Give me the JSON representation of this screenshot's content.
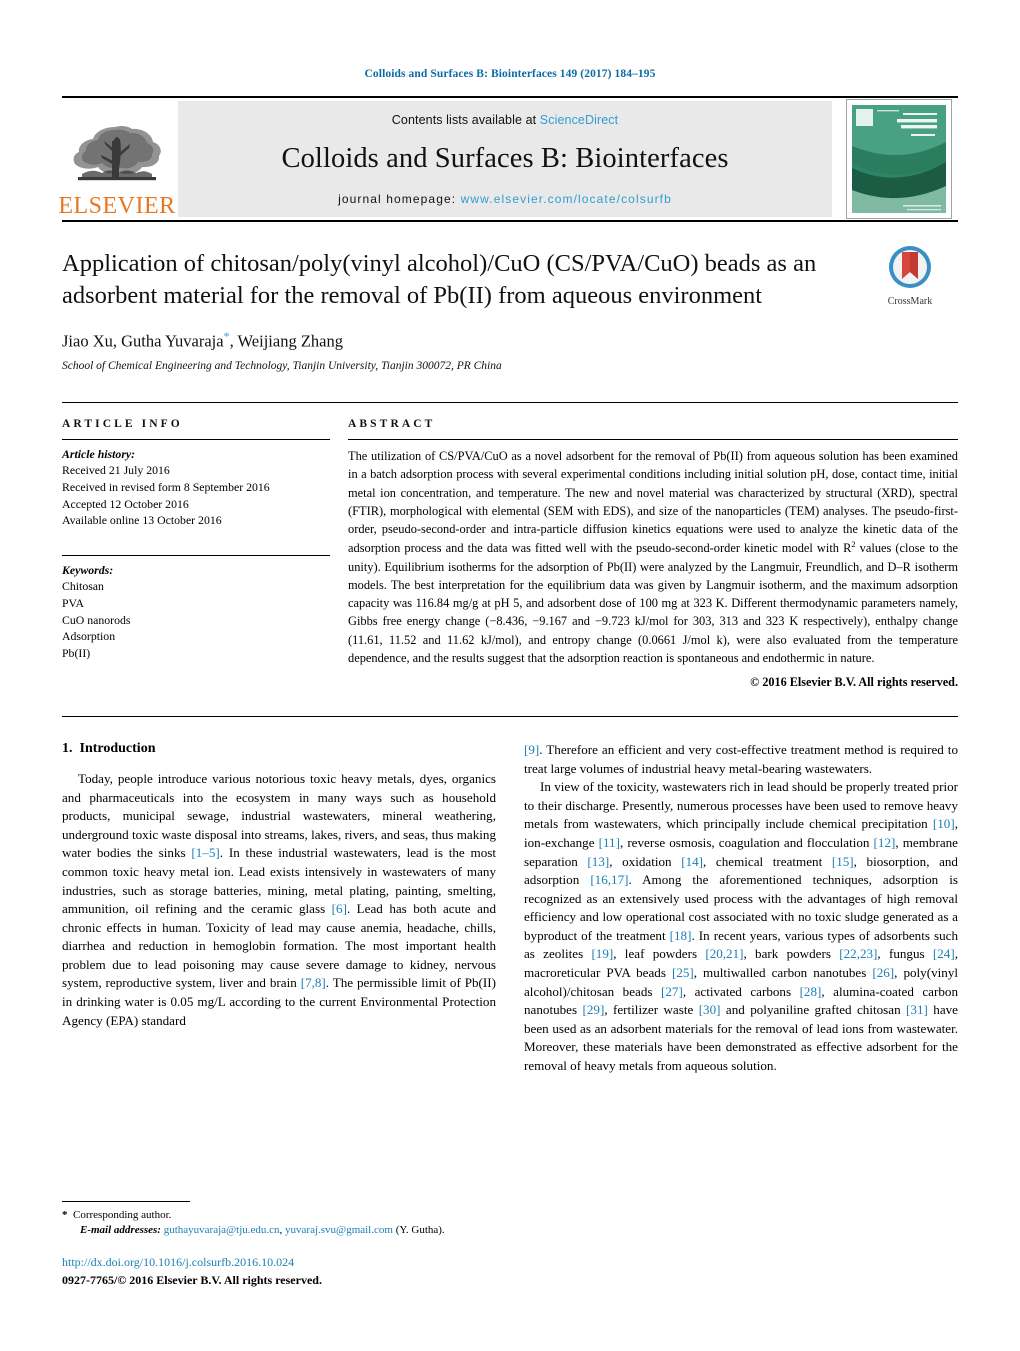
{
  "running_head": "Colloids and Surfaces B: Biointerfaces 149 (2017) 184–195",
  "masthead": {
    "publisher_name": "ELSEVIER",
    "contents_prefix": "Contents lists available at ",
    "contents_link": "ScienceDirect",
    "journal_title": "Colloids and Surfaces B: Biointerfaces",
    "homepage_prefix": "journal homepage: ",
    "homepage_url": "www.elsevier.com/locate/colsurfb",
    "cover_title_small": "An International Journal of",
    "cover_title_main": "COLLOIDS AND SURFACES B",
    "cover_subtitle": "Biointerfaces",
    "link_color": "#2f9fd0"
  },
  "article": {
    "title": "Application of chitosan/poly(vinyl alcohol)/CuO (CS/PVA/CuO) beads as an adsorbent material for the removal of Pb(II) from aqueous environment",
    "crossmark_label": "CrossMark",
    "authors": "Jiao Xu, Gutha Yuvaraja",
    "authors_tail": ", Weijiang Zhang",
    "corresponding_marker": "*",
    "affiliation": "School of Chemical Engineering and Technology, Tianjin University, Tianjin 300072, PR China"
  },
  "article_info": {
    "heading": "ARTICLE INFO",
    "history_label": "Article history:",
    "history": [
      "Received 21 July 2016",
      "Received in revised form 8 September 2016",
      "Accepted 12 October 2016",
      "Available online 13 October 2016"
    ],
    "keywords_label": "Keywords:",
    "keywords": [
      "Chitosan",
      "PVA",
      "CuO nanorods",
      "Adsorption",
      "Pb(II)"
    ]
  },
  "abstract": {
    "heading": "ABSTRACT",
    "text_part1": "The utilization of CS/PVA/CuO as a novel adsorbent for the removal of Pb(II) from aqueous solution has been examined in a batch adsorption process with several experimental conditions including initial solution pH, dose, contact time, initial metal ion concentration, and temperature. The new and novel material was characterized by structural (XRD), spectral (FTIR), morphological with elemental (SEM with EDS), and size of the nanoparticles (TEM) analyses. The pseudo-first-order, pseudo-second-order and intra-particle diffusion kinetics equations were used to analyze the kinetic data of the adsorption process and the data was fitted well with the pseudo-second-order kinetic model with R",
    "superscript": "2",
    "text_part2": " values (close to the unity). Equilibrium isotherms for the adsorption of Pb(II) were analyzed by the Langmuir, Freundlich, and D–R isotherm models. The best interpretation for the equilibrium data was given by Langmuir isotherm, and the maximum adsorption capacity was 116.84 mg/g at pH 5, and adsorbent dose of 100 mg at 323 K. Different thermodynamic parameters namely, Gibbs free energy change (−8.436, −9.167 and −9.723 kJ/mol for 303, 313 and 323 K respectively), enthalpy change (11.61, 11.52 and 11.62 kJ/mol), and entropy change (0.0661 J/mol k), were also evaluated from the temperature dependence, and the results suggest that the adsorption reaction is spontaneous and endothermic in nature.",
    "copyright": "© 2016 Elsevier B.V. All rights reserved."
  },
  "introduction": {
    "section_number": "1.",
    "section_title": "Introduction",
    "left_para_1_a": "Today, people introduce various notorious toxic heavy metals, dyes, organics and pharmaceuticals into the ecosystem in many ways such as household products, municipal sewage, industrial wastewaters, mineral weathering, underground toxic waste disposal into streams, lakes, rivers, and seas, thus making water bodies the sinks ",
    "ref_1_5": "[1–5]",
    "left_para_1_b": ". In these industrial wastewaters, lead is the most common toxic heavy metal ion. Lead exists intensively in wastewaters of many industries, such as storage batteries, mining, metal plating, painting, smelting, ammunition, oil refining and the ceramic glass ",
    "ref_6": "[6]",
    "left_para_1_c": ". Lead has both acute and chronic effects in human. Toxicity of lead may cause anemia, headache, chills, diarrhea and reduction in hemoglobin formation. The most important health problem due to lead poisoning may cause severe damage to kidney, nervous system, reproductive system, liver and brain ",
    "ref_7_8": "[7,8]",
    "left_para_1_d": ". The permissible limit of Pb(II) in drinking water is 0.05 mg/L according to the current Environmental Protection Agency (EPA) standard ",
    "ref_9": "[9]",
    "right_para_1_a": ". Therefore an efficient and very cost-effective treatment method is required to treat large volumes of industrial heavy metal-bearing wastewaters.",
    "right_para_2_a": "In view of the toxicity, wastewaters rich in lead should be properly treated prior to their discharge. Presently, numerous processes have been used to remove heavy metals from wastewaters, which principally include chemical precipitation ",
    "ref_10": "[10]",
    "right_para_2_b": ", ion-exchange ",
    "ref_11": "[11]",
    "right_para_2_c": ", reverse osmosis, coagulation and flocculation ",
    "ref_12": "[12]",
    "right_para_2_d": ", membrane separation ",
    "ref_13": "[13]",
    "right_para_2_e": ", oxidation ",
    "ref_14": "[14]",
    "right_para_2_f": ", chemical treatment ",
    "ref_15": "[15]",
    "right_para_2_g": ", biosorption, and adsorption ",
    "ref_16_17": "[16,17]",
    "right_para_2_h": ". Among the aforementioned techniques, adsorption is recognized as an extensively used process with the advantages of high removal efficiency and low operational cost associated with no toxic sludge generated as a byproduct of the treatment ",
    "ref_18": "[18]",
    "right_para_2_i": ". In recent years, various types of adsorbents such as zeolites ",
    "ref_19": "[19]",
    "right_para_2_j": ", leaf powders ",
    "ref_20_21": "[20,21]",
    "right_para_2_k": ", bark powders ",
    "ref_22_23": "[22,23]",
    "right_para_2_l": ", fungus ",
    "ref_24": "[24]",
    "right_para_2_m": ", macroreticular PVA beads ",
    "ref_25": "[25]",
    "right_para_2_n": ", multiwalled carbon nanotubes ",
    "ref_26": "[26]",
    "right_para_2_o": ", poly(vinyl alcohol)/chitosan beads ",
    "ref_27": "[27]",
    "right_para_2_p": ", activated carbons ",
    "ref_28": "[28]",
    "right_para_2_q": ", alumina-coated carbon nanotubes ",
    "ref_29": "[29]",
    "right_para_2_r": ", fertilizer waste ",
    "ref_30": "[30]",
    "right_para_2_s": " and polyaniline grafted chitosan ",
    "ref_31": "[31]",
    "right_para_2_t": " have been used as an adsorbent materials for the removal of lead ions from wastewater. Moreover, these materials have been demonstrated as effective adsorbent for the removal of heavy metals from aqueous solution."
  },
  "footnote": {
    "corresponding_star": "*",
    "corresponding_text": "Corresponding author.",
    "email_label": "E-mail addresses:",
    "email_1": "guthayuvaraja@tju.edu.cn",
    "email_sep": ", ",
    "email_2": "yuvaraj.svu@gmail.com",
    "email_attrib": " (Y. Gutha).",
    "doi": "http://dx.doi.org/10.1016/j.colsurfb.2016.10.024",
    "issn_line": "0927-7765/© 2016 Elsevier B.V. All rights reserved."
  }
}
